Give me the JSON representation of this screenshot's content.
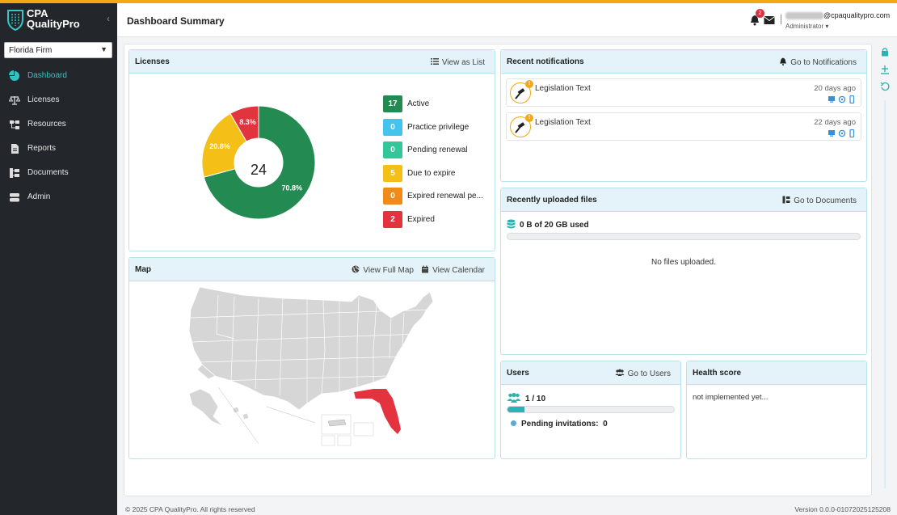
{
  "brand": {
    "name_line1": "CPA",
    "name_line2": "QualityPro"
  },
  "firm_select": {
    "value": "Florida Firm"
  },
  "nav": {
    "items": [
      {
        "label": "Dashboard",
        "icon": "pie-chart-icon",
        "active": true
      },
      {
        "label": "Licenses",
        "icon": "scale-icon"
      },
      {
        "label": "Resources",
        "icon": "sitemap-icon"
      },
      {
        "label": "Reports",
        "icon": "report-icon"
      },
      {
        "label": "Documents",
        "icon": "documents-icon"
      },
      {
        "label": "Admin",
        "icon": "server-icon"
      }
    ]
  },
  "header": {
    "title": "Dashboard Summary",
    "bell_badge": "2",
    "email_suffix": "@cpaqualitypro.com",
    "role": "Administrator"
  },
  "licenses": {
    "title": "Licenses",
    "view_list_label": "View as List",
    "total": "24",
    "slice_labels": {
      "active": "70.8%",
      "due": "20.8%",
      "expired": "8.3%"
    },
    "legend": [
      {
        "count": "17",
        "label": "Active",
        "color": "#238a52"
      },
      {
        "count": "0",
        "label": "Practice privilege",
        "color": "#44c3ec"
      },
      {
        "count": "0",
        "label": "Pending renewal",
        "color": "#33c699"
      },
      {
        "count": "5",
        "label": "Due to expire",
        "color": "#f4c017"
      },
      {
        "count": "0",
        "label": "Expired renewal pe...",
        "color": "#f08a18"
      },
      {
        "count": "2",
        "label": "Expired",
        "color": "#e2333f"
      }
    ],
    "chart_data": {
      "type": "pie",
      "categories": [
        "Active",
        "Practice privilege",
        "Pending renewal",
        "Due to expire",
        "Expired renewal pe...",
        "Expired"
      ],
      "values": [
        17,
        0,
        0,
        5,
        0,
        2
      ],
      "data_labels": [
        "70.8%",
        "",
        "",
        "20.8%",
        "",
        "8.3%"
      ]
    }
  },
  "map": {
    "title": "Map",
    "view_full_label": "View Full Map",
    "view_calendar_label": "View Calendar",
    "highlight_color": "#e2333f"
  },
  "notifications": {
    "title": "Recent notifications",
    "go_label": "Go to Notifications",
    "items": [
      {
        "title": "Legislation Text",
        "time": "20 days ago",
        "badge": "!"
      },
      {
        "title": "Legislation Text",
        "time": "22 days ago",
        "badge": "!"
      }
    ]
  },
  "files": {
    "title": "Recently uploaded files",
    "go_label": "Go to Documents",
    "storage_used": "0 B of 20 GB used",
    "empty_text": "No files uploaded."
  },
  "users": {
    "title": "Users",
    "go_label": "Go to Users",
    "count_text": "1 / 10",
    "fill_fraction": 0.1,
    "pending_label": "Pending invitations:",
    "pending_count": "0"
  },
  "health": {
    "title": "Health score",
    "text": "not implemented yet..."
  },
  "footer": {
    "copyright": "© 2025 CPA QualityPro. All rights reserved",
    "version": "Version 0.0.0-01072025125208"
  }
}
